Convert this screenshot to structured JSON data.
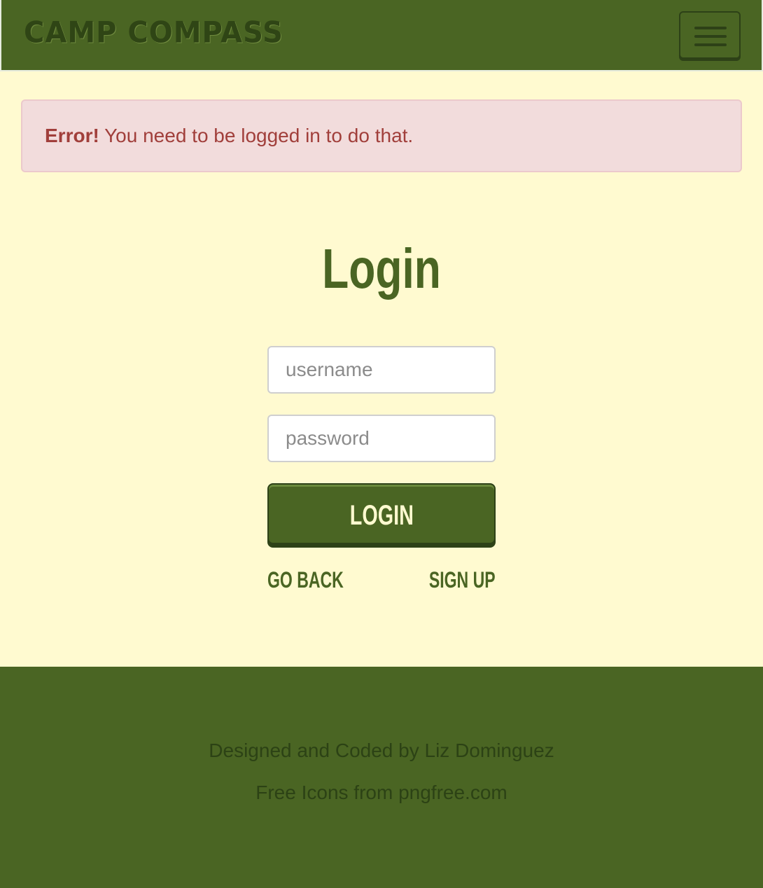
{
  "navbar": {
    "brand": "CAMP COMPASS",
    "toggle_icon": "hamburger-menu-icon"
  },
  "alert": {
    "strong": "Error!",
    "message": " You need to be logged in to do that."
  },
  "login": {
    "title": "Login",
    "username_placeholder": "username",
    "password_placeholder": "password",
    "submit_label": "LOGIN",
    "go_back_label": "GO BACK",
    "sign_up_label": "SIGN UP"
  },
  "footer": {
    "credit": "Designed and Coded by Liz Dominguez",
    "icons_credit": "Free Icons from pngfree.com"
  },
  "colors": {
    "primary_green": "#4a6523",
    "background_cream": "#fffad0",
    "alert_bg": "#f2dcdc",
    "alert_text": "#a13f3b"
  }
}
